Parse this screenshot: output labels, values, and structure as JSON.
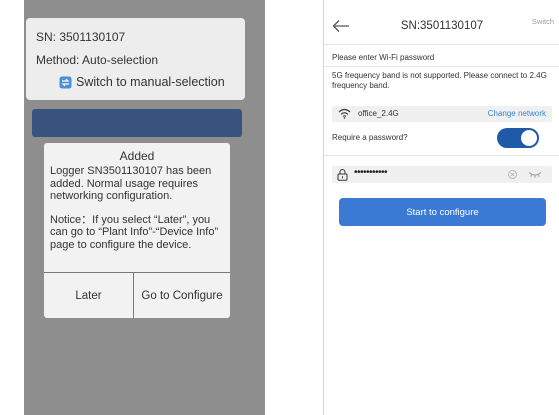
{
  "left": {
    "sn_label": "SN: 3501130107",
    "method_label": "Method: Auto-selection",
    "switch_label": "Switch to manual-selection",
    "dialog": {
      "title": "Added",
      "message": "Logger SN3501130107 has been added. Normal usage requires networking configuration.",
      "notice": "Notice：If you select “Later”, you can go to “Plant Info”-“Device Info” page to configure the device.",
      "later_label": "Later",
      "configure_label": "Go to Configure"
    }
  },
  "right": {
    "title": "SN:3501130107",
    "switch_label": "Switch",
    "prompt": "Please enter Wi-Fi password",
    "freq_note": "5G frequency band is not supported. Please connect to 2.4G frequency band.",
    "network_name": "office_2.4G",
    "change_network_label": "Change network",
    "require_password_label": "Require a password?",
    "require_password_on": true,
    "password_value": "•••••••••••",
    "start_label": "Start to configure"
  },
  "colors": {
    "overlay_gray": "#8e8e8e",
    "dark_blue_bar": "#38547e",
    "toggle_blue": "#1e5aa8",
    "button_blue": "#3a7ad5",
    "link_blue": "#3b84d4"
  },
  "icons": [
    "switch-icon",
    "back-arrow-icon",
    "wifi-icon",
    "lock-icon",
    "clear-icon",
    "eye-hidden-icon"
  ]
}
